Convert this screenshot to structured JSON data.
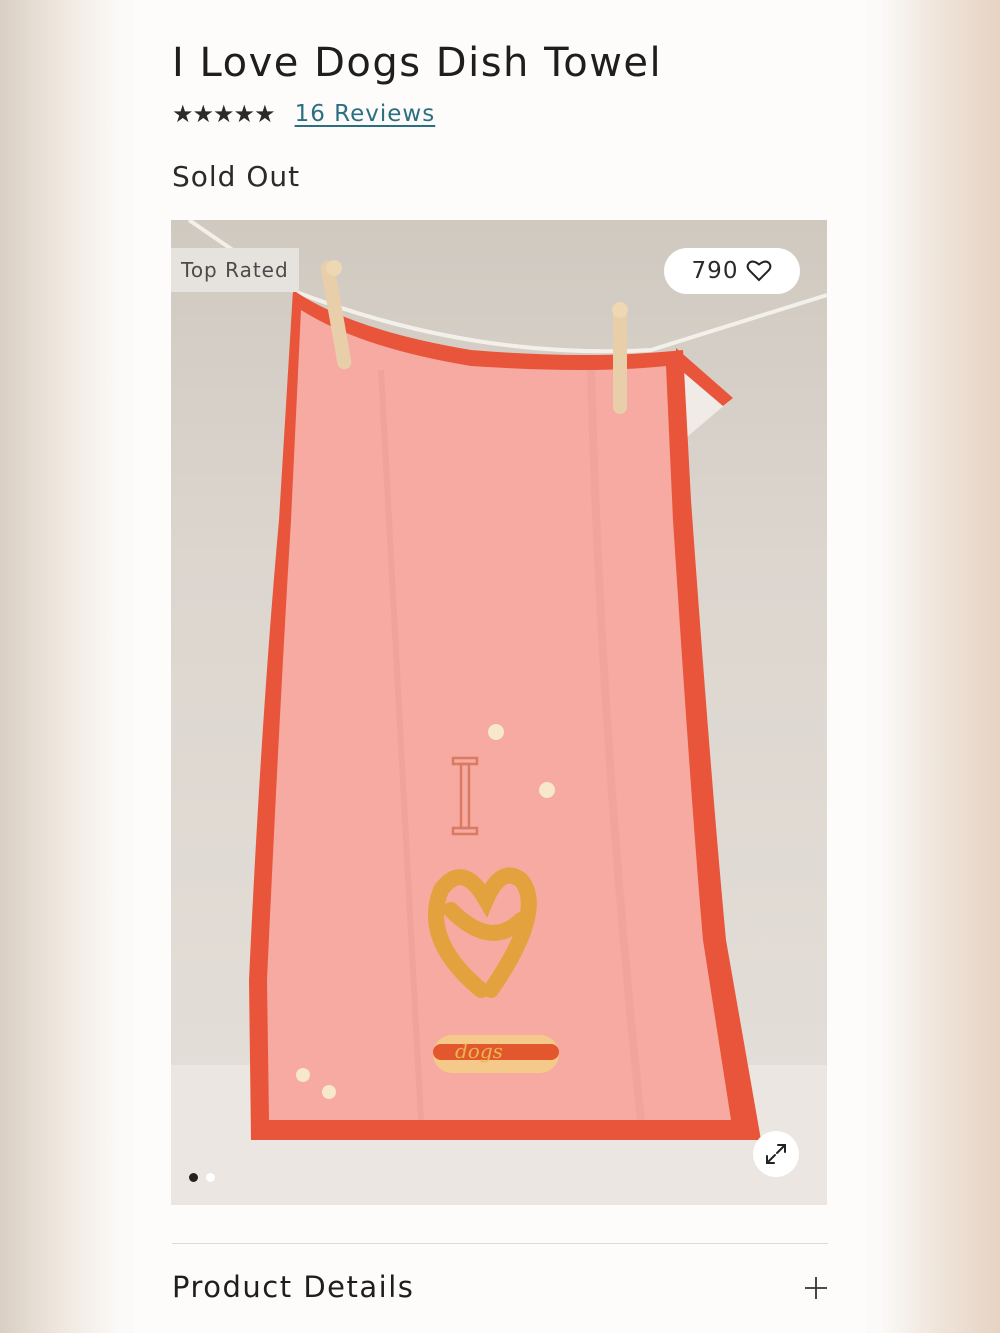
{
  "product": {
    "title": "I Love Dogs Dish Towel",
    "stars": "★★★★★",
    "reviews_label": "16 Reviews",
    "status": "Sold Out"
  },
  "gallery": {
    "badge": "Top Rated",
    "favorite_count": "790",
    "slide_count": 2,
    "active_slide": 1,
    "towel_text": "dogs"
  },
  "accordion": {
    "product_details_label": "Product Details"
  },
  "icons": [
    "heart-icon",
    "expand-icon",
    "plus-icon"
  ],
  "colors": {
    "towel": "#f5a9a0",
    "towel_border": "#e8553a",
    "link": "#2b6f82"
  }
}
